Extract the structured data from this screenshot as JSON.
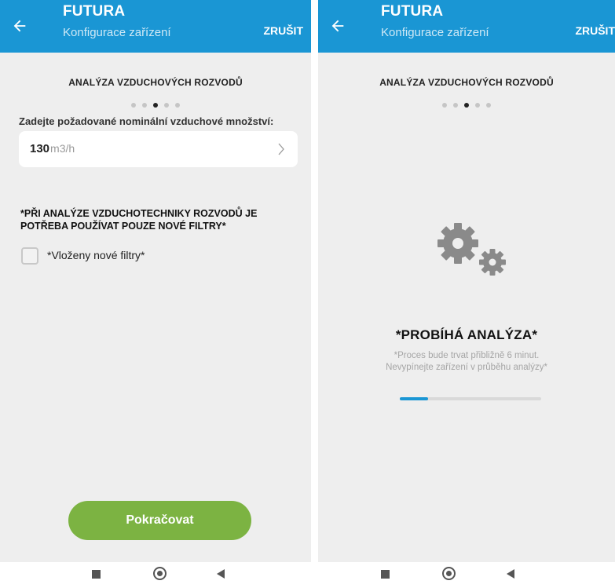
{
  "app": {
    "title": "FUTURA",
    "subtitle": "Konfigurace zařízení",
    "cancel_label": "ZRUŠIT"
  },
  "colors": {
    "accent": "#1a96d4",
    "button_green": "#7cb342",
    "background": "#eeeeee"
  },
  "wizard": {
    "section_title": "ANALÝZA VZDUCHOVÝCH ROZVODŮ",
    "step_total": 5,
    "step_current": 3
  },
  "config_screen": {
    "prompt_label": "Zadejte požadované nominální vzduchové množství:",
    "air_volume": {
      "value": "130",
      "unit": "m3/h"
    },
    "warning": "*PŘI ANALÝZE VZDUCHOTECHNIKY ROZVODŮ JE POTŘEBA POUŽÍVAT POUZE NOVÉ FILTRY*",
    "checkbox_label": "*Vloženy nové filtry*",
    "checkbox_checked": false,
    "continue_label": "Pokračovat"
  },
  "analysis_screen": {
    "status_title": "*PROBÍHÁ ANALÝZA*",
    "desc_line1": "*Proces bude trvat přibližně 6 minut.",
    "desc_line2": "Nevypínejte zařízení v průběhu analýzy*",
    "progress_fraction": 0.2,
    "icon": "gears-icon"
  },
  "navbar": {
    "icons": [
      "recents-square-icon",
      "home-circle-icon",
      "back-triangle-icon"
    ]
  }
}
